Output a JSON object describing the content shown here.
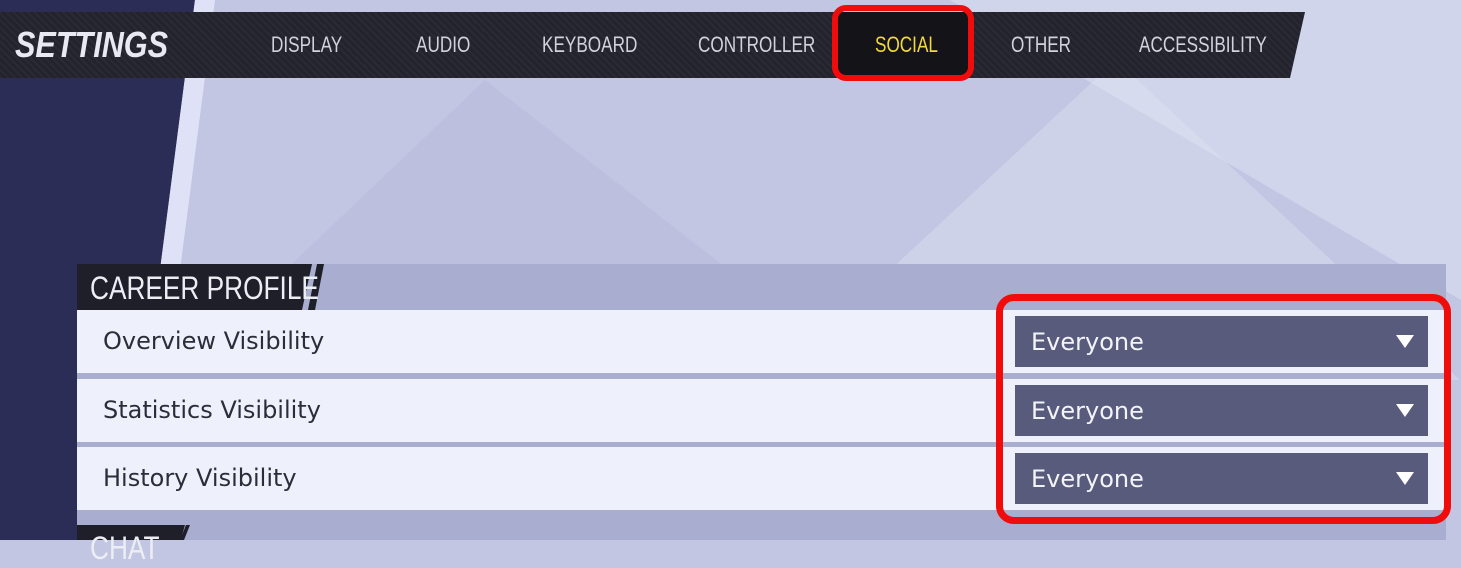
{
  "header": {
    "title": "SETTINGS",
    "tabs": [
      {
        "label": "DISPLAY"
      },
      {
        "label": "AUDIO"
      },
      {
        "label": "KEYBOARD"
      },
      {
        "label": "CONTROLLER"
      },
      {
        "label": "SOCIAL",
        "active": true
      },
      {
        "label": "OTHER"
      },
      {
        "label": "ACCESSIBILITY"
      }
    ]
  },
  "sections": [
    {
      "title": "CAREER PROFILE",
      "rows": [
        {
          "label": "Overview Visibility",
          "value": "Everyone"
        },
        {
          "label": "Statistics Visibility",
          "value": "Everyone"
        },
        {
          "label": "History Visibility",
          "value": "Everyone"
        }
      ]
    },
    {
      "title": "CHAT"
    }
  ],
  "colors": {
    "active_tab": "#f3d83c",
    "highlight": "#f10c0c",
    "dropdown_bg": "#595b7d"
  }
}
